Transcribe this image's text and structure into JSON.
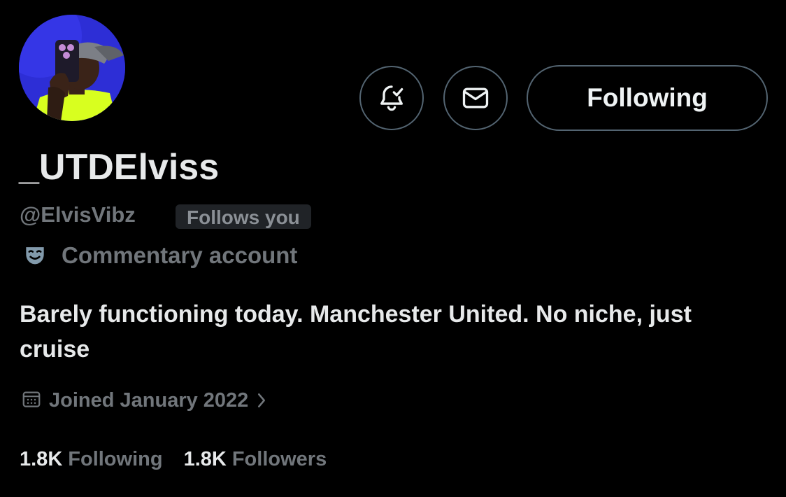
{
  "profile": {
    "display_name": "_UTDElviss",
    "handle": "@ElvisVibz",
    "follows_you_badge": "Follows you",
    "account_label": "Commentary account",
    "bio": "Barely functioning today. Manchester United. No niche, just cruise",
    "joined": "Joined January 2022"
  },
  "actions": {
    "notify_icon": "bell-check-icon",
    "message_icon": "envelope-icon",
    "following_label": "Following"
  },
  "stats": {
    "following_count": "1.8K",
    "following_label": "Following",
    "followers_count": "1.8K",
    "followers_label": "Followers"
  },
  "colors": {
    "background": "#000000",
    "primary_text": "#e7e9ea",
    "secondary_text": "#71767b",
    "button_border": "#536471",
    "badge_background": "#202327",
    "avatar_background": "#2b2bd8",
    "label_icon": "#829aab"
  }
}
